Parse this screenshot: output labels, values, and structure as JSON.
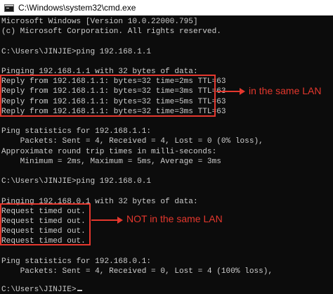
{
  "window": {
    "title": "C:\\Windows\\system32\\cmd.exe",
    "icon": "cmd-app-icon"
  },
  "console": {
    "lines": [
      "Microsoft Windows [Version 10.0.22000.795]",
      "(c) Microsoft Corporation. All rights reserved.",
      "",
      "C:\\Users\\JINJIE>ping 192.168.1.1",
      "",
      "Pinging 192.168.1.1 with 32 bytes of data:",
      "Reply from 192.168.1.1: bytes=32 time=2ms TTL=63",
      "Reply from 192.168.1.1: bytes=32 time=3ms TTL=63",
      "Reply from 192.168.1.1: bytes=32 time=5ms TTL=63",
      "Reply from 192.168.1.1: bytes=32 time=3ms TTL=63",
      "",
      "Ping statistics for 192.168.1.1:",
      "    Packets: Sent = 4, Received = 4, Lost = 0 (0% loss),",
      "Approximate round trip times in milli-seconds:",
      "    Minimum = 2ms, Maximum = 5ms, Average = 3ms",
      "",
      "C:\\Users\\JINJIE>ping 192.168.0.1",
      "",
      "Pinging 192.168.0.1 with 32 bytes of data:",
      "Request timed out.",
      "Request timed out.",
      "Request timed out.",
      "Request timed out.",
      "",
      "Ping statistics for 192.168.0.1:",
      "    Packets: Sent = 4, Received = 0, Lost = 4 (100% loss),",
      "",
      "C:\\Users\\JINJIE>"
    ]
  },
  "annotations": {
    "same_lan_label": "in the same LAN",
    "not_same_lan_label": "NOT in the same LAN",
    "color": "#e4372d"
  },
  "colors": {
    "console_background": "#0c0c0c",
    "console_text": "#cccccc",
    "titlebar_background": "#ffffff"
  }
}
